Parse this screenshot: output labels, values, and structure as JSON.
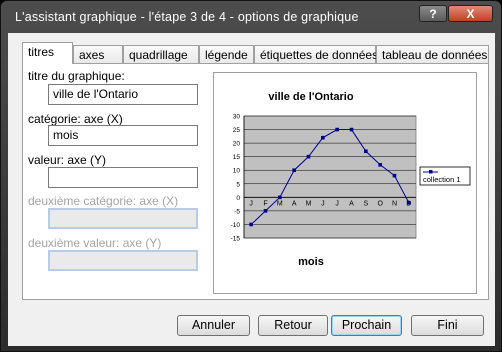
{
  "window": {
    "title": "L'assistant graphique - l'étape 3 de 4 -  options de graphique",
    "help": "?",
    "close": "X"
  },
  "tabs": [
    "titres",
    "axes",
    "quadrillage",
    "légende",
    "étiquettes de données",
    "tableau de données"
  ],
  "form": {
    "chart_title_label": "titre du graphique:",
    "chart_title_value": "ville de l'Ontario",
    "category_label": "catégorie: axe (X)",
    "category_value": "mois",
    "value_label": "valeur: axe (Y)",
    "value_value": "",
    "second_category_label": "deuxième catégorie: axe (X)",
    "second_value_label": "deuxième valeur: axe (Y)"
  },
  "chart_data": {
    "type": "line",
    "title": "ville de l'Ontario",
    "xlabel": "mois",
    "ylabel": "",
    "categories": [
      "J",
      "F",
      "M",
      "A",
      "M",
      "J",
      "J",
      "A",
      "S",
      "O",
      "N",
      "D"
    ],
    "series": [
      {
        "name": "collection 1",
        "values": [
          -10,
          -5,
          0,
          10,
          15,
          22,
          25,
          25,
          17,
          12,
          8,
          -2
        ]
      }
    ],
    "ylim": [
      -15,
      30
    ],
    "yticks": [
      "30",
      "25",
      "20",
      "15",
      "10",
      "5",
      "0",
      "-5",
      "-10",
      "-15"
    ],
    "grid": true,
    "legend": "right",
    "plot_color": "#c0c0c0",
    "line_color": "#00008b"
  },
  "buttons": {
    "cancel": "Annuler",
    "back": "Retour",
    "next": "Prochain",
    "finish": "Fini"
  }
}
